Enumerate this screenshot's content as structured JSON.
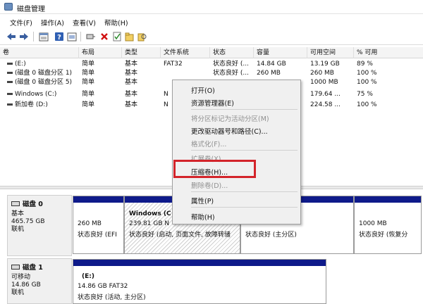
{
  "window": {
    "title": "磁盘管理"
  },
  "menubar": [
    "文件(F)",
    "操作(A)",
    "查看(V)",
    "帮助(H)"
  ],
  "toolbar": {
    "icons": [
      "back-arrow-icon",
      "forward-arrow-icon",
      "properties-icon",
      "help-icon",
      "console-icon",
      "connect-icon",
      "delete-icon",
      "check-icon",
      "new-folder-icon",
      "search-icon"
    ]
  },
  "volume_list": {
    "columns": [
      "卷",
      "布局",
      "类型",
      "文件系统",
      "状态",
      "容量",
      "可用空间",
      "% 可用"
    ],
    "rows": [
      {
        "vol": "(E:)",
        "layout": "简单",
        "type": "基本",
        "fs": "FAT32",
        "status": "状态良好 (...",
        "capacity": "14.84 GB",
        "free": "13.19 GB",
        "pct": "89 %"
      },
      {
        "vol": "(磁盘 0 磁盘分区 1)",
        "layout": "简单",
        "type": "基本",
        "fs": "",
        "status": "状态良好 (...",
        "capacity": "260 MB",
        "free": "260 MB",
        "pct": "100 %"
      },
      {
        "vol": "(磁盘 0 磁盘分区 5)",
        "layout": "简单",
        "type": "基本",
        "fs": "",
        "status": "",
        "capacity": "",
        "free": "1000 MB",
        "pct": "100 %"
      },
      {
        "vol": "Windows (C:)",
        "layout": "简单",
        "type": "基本",
        "fs": "N",
        "status": "",
        "capacity": "",
        "free": "179.64 ...",
        "pct": "75 %"
      },
      {
        "vol": "新加卷 (D:)",
        "layout": "简单",
        "type": "基本",
        "fs": "N",
        "status": "",
        "capacity": "",
        "free": "224.58 ...",
        "pct": "100 %"
      }
    ]
  },
  "context_menu": {
    "items": [
      {
        "label": "打开(O)",
        "enabled": true
      },
      {
        "label": "资源管理器(E)",
        "enabled": true
      },
      {
        "label": "将分区标记为活动分区(M)",
        "enabled": false
      },
      {
        "label": "更改驱动器号和路径(C)...",
        "enabled": true
      },
      {
        "label": "格式化(F)...",
        "enabled": false
      },
      {
        "label": "扩展卷(X)...",
        "enabled": false
      },
      {
        "label": "压缩卷(H)...",
        "enabled": true,
        "highlighted": true
      },
      {
        "label": "删除卷(D)...",
        "enabled": false
      },
      {
        "label": "属性(P)",
        "enabled": true
      },
      {
        "label": "帮助(H)",
        "enabled": true
      }
    ]
  },
  "disks": [
    {
      "name": "磁盘 0",
      "kind": "基本",
      "size": "465.75 GB",
      "state": "联机",
      "partitions": [
        {
          "title": "",
          "line1": "260 MB",
          "line2": "状态良好 (EFI"
        },
        {
          "title": "Windows (C",
          "line1": "239.81 GB N",
          "line2": "状态良好 (启动, 页面文件, 故障转储"
        },
        {
          "title": "",
          "line1": "",
          "line2": "状态良好 (主分区)"
        },
        {
          "title": "",
          "line1": "1000 MB",
          "line2": "状态良好 (恢复分"
        }
      ]
    },
    {
      "name": "磁盘 1",
      "kind": "可移动",
      "size": "14.86 GB",
      "state": "联机",
      "partitions": [
        {
          "title": "(E:)",
          "line1": "14.86 GB FAT32",
          "line2": "状态良好 (活动, 主分区)"
        }
      ]
    }
  ],
  "colors": {
    "partition_header": "#0e1a8a",
    "highlight_box": "#d3242a",
    "delete_icon": "#d01010"
  }
}
